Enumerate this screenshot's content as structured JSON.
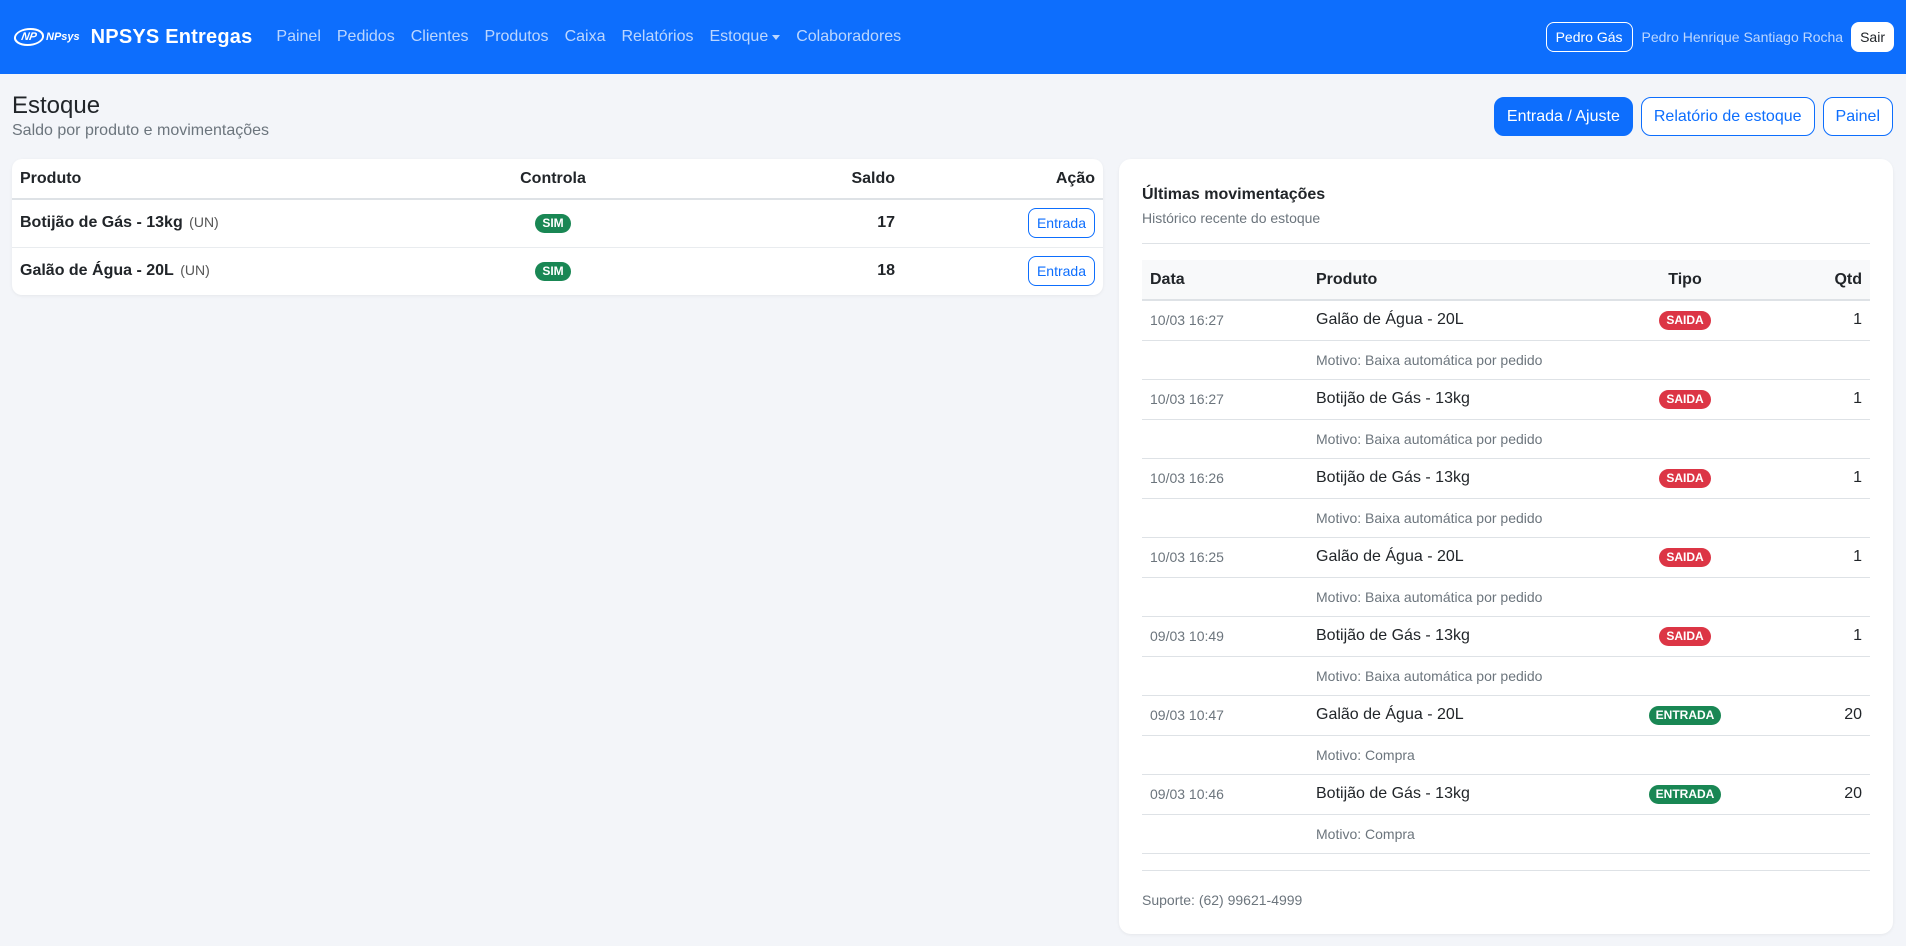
{
  "app": {
    "brand_logo_mark": "NP",
    "brand_logo_text": "NPsys",
    "brand_name": "NPSYS Entregas"
  },
  "nav": {
    "items": [
      "Painel",
      "Pedidos",
      "Clientes",
      "Produtos",
      "Caixa",
      "Relatórios",
      "Estoque",
      "Colaboradores"
    ],
    "dropdown_item": "Estoque"
  },
  "user": {
    "tenant": "Pedro Gás",
    "name": "Pedro Henrique Santiago Rocha",
    "logout": "Sair"
  },
  "page": {
    "title": "Estoque",
    "subtitle": "Saldo por produto e movimentações",
    "actions": {
      "entry_adjust": "Entrada / Ajuste",
      "stock_report": "Relatório de estoque",
      "dashboard": "Painel"
    }
  },
  "stock_table": {
    "headers": {
      "product": "Produto",
      "controls": "Controla",
      "balance": "Saldo",
      "action": "Ação"
    },
    "rows": [
      {
        "product": "Botijão de Gás - 13kg",
        "unit": "(UN)",
        "controls": "SIM",
        "balance": "17",
        "action": "Entrada"
      },
      {
        "product": "Galão de Água - 20L",
        "unit": "(UN)",
        "controls": "SIM",
        "balance": "18",
        "action": "Entrada"
      }
    ]
  },
  "movements": {
    "title": "Últimas movimentações",
    "subtitle": "Histórico recente do estoque",
    "headers": {
      "date": "Data",
      "product": "Produto",
      "type": "Tipo",
      "qty": "Qtd"
    },
    "rows": [
      {
        "date": "10/03 16:27",
        "product": "Galão de Água - 20L",
        "type": "SAIDA",
        "qty": "1",
        "reason": "Motivo: Baixa automática por pedido"
      },
      {
        "date": "10/03 16:27",
        "product": "Botijão de Gás - 13kg",
        "type": "SAIDA",
        "qty": "1",
        "reason": "Motivo: Baixa automática por pedido"
      },
      {
        "date": "10/03 16:26",
        "product": "Botijão de Gás - 13kg",
        "type": "SAIDA",
        "qty": "1",
        "reason": "Motivo: Baixa automática por pedido"
      },
      {
        "date": "10/03 16:25",
        "product": "Galão de Água - 20L",
        "type": "SAIDA",
        "qty": "1",
        "reason": "Motivo: Baixa automática por pedido"
      },
      {
        "date": "09/03 10:49",
        "product": "Botijão de Gás - 13kg",
        "type": "SAIDA",
        "qty": "1",
        "reason": "Motivo: Baixa automática por pedido"
      },
      {
        "date": "09/03 10:47",
        "product": "Galão de Água - 20L",
        "type": "ENTRADA",
        "qty": "20",
        "reason": "Motivo: Compra"
      },
      {
        "date": "09/03 10:46",
        "product": "Botijão de Gás - 13kg",
        "type": "ENTRADA",
        "qty": "20",
        "reason": "Motivo: Compra"
      }
    ],
    "support": "Suporte: (62) 99621-4999"
  },
  "colors": {
    "primary": "#0d6efd",
    "success": "#198754",
    "danger": "#dc3545",
    "page_bg": "#f3f5f9"
  }
}
